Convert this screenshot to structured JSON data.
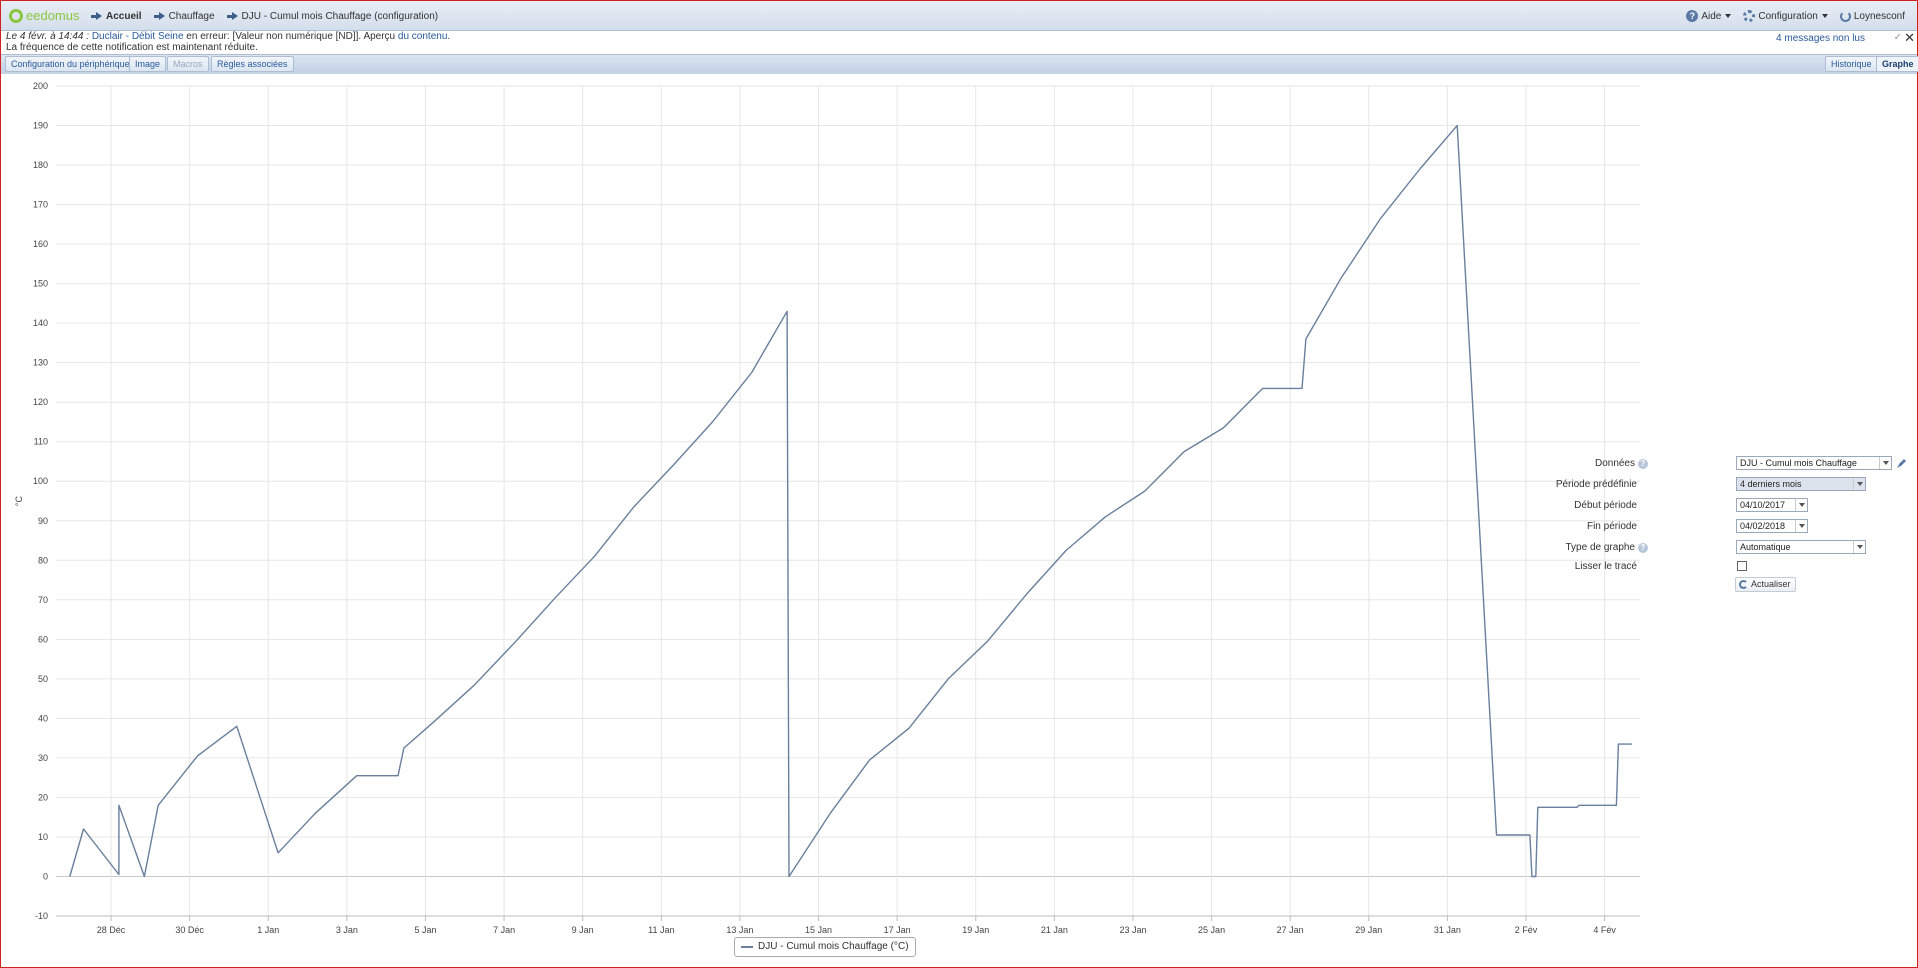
{
  "app": {
    "logo_text": "eedomus"
  },
  "breadcrumb": [
    "Accueil",
    "Chauffage",
    "DJU - Cumul mois Chauffage (configuration)"
  ],
  "topright": {
    "help": "Aide",
    "config": "Configuration",
    "user": "Loynesconf"
  },
  "notification": {
    "date": "Le 4 févr. à 14:44 :",
    "device": "Duclair - Débit Seine",
    "text1": " en erreur: [Valeur non numérique [ND]]. Aperçu ",
    "link": "du contenu",
    "text2": ".",
    "line2": "La fréquence de cette notification est maintenant réduite.",
    "unread": "4 messages non lus",
    "close": "✕"
  },
  "tabs": {
    "config": "Configuration du périphérique",
    "image": "Image",
    "macros": "Macros",
    "rules": "Règles associées",
    "history": "Historique",
    "graph": "Graphe"
  },
  "form": {
    "data_label": "Données",
    "data_value": "DJU - Cumul mois Chauffage",
    "period_label": "Période prédéfinie",
    "period_value": "4 derniers mois",
    "start_label": "Début période",
    "start_value": "04/10/2017",
    "end_label": "Fin période",
    "end_value": "04/02/2018",
    "type_label": "Type de graphe",
    "type_value": "Automatique",
    "smooth_label": "Lisser le tracé",
    "smooth_checked": false,
    "refresh_button": "Actualiser"
  },
  "chart_data": {
    "type": "line",
    "title": "",
    "ylabel": "°C",
    "xlabel": "",
    "ylim": [
      -10,
      200
    ],
    "yticks": [
      -10,
      0,
      10,
      20,
      30,
      40,
      50,
      60,
      70,
      80,
      90,
      100,
      110,
      120,
      130,
      140,
      150,
      160,
      170,
      180,
      190,
      200
    ],
    "xticks": [
      "28 Déc",
      "30 Déc",
      "1 Jan",
      "3 Jan",
      "5 Jan",
      "7 Jan",
      "9 Jan",
      "11 Jan",
      "13 Jan",
      "15 Jan",
      "17 Jan",
      "19 Jan",
      "21 Jan",
      "23 Jan",
      "25 Jan",
      "27 Jan",
      "29 Jan",
      "31 Jan",
      "2 Fév",
      "4 Fév"
    ],
    "xtick_days": [
      0,
      2,
      4,
      6,
      8,
      10,
      12,
      14,
      16,
      18,
      20,
      22,
      24,
      26,
      28,
      30,
      32,
      34,
      36,
      38
    ],
    "xlim_days": [
      -1.4,
      38.9
    ],
    "grid": true,
    "legend": "bottom-center",
    "series": [
      {
        "name": "DJU - Cumul mois Chauffage (°C)",
        "color": "#6a7f9c",
        "points_day": [
          [
            -1.05,
            0
          ],
          [
            -0.7,
            12
          ],
          [
            0.2,
            0.5
          ],
          [
            0.2,
            18
          ],
          [
            0.85,
            0
          ],
          [
            1.2,
            18
          ],
          [
            2.2,
            30.5
          ],
          [
            3.2,
            38
          ],
          [
            4.25,
            6
          ],
          [
            5.2,
            16
          ],
          [
            6.25,
            25.5
          ],
          [
            7.3,
            25.5
          ],
          [
            7.45,
            32.5
          ],
          [
            8.2,
            39
          ],
          [
            9.25,
            48.5
          ],
          [
            10.3,
            59.5
          ],
          [
            11.3,
            70.5
          ],
          [
            12.3,
            81
          ],
          [
            13.3,
            93.5
          ],
          [
            14.3,
            104
          ],
          [
            15.3,
            115
          ],
          [
            16.3,
            127.5
          ],
          [
            17.2,
            143
          ],
          [
            17.25,
            0
          ],
          [
            18.3,
            16
          ],
          [
            19.3,
            29.5
          ],
          [
            20.3,
            37.5
          ],
          [
            21.3,
            50
          ],
          [
            22.3,
            59.5
          ],
          [
            23.3,
            71.5
          ],
          [
            24.3,
            82.5
          ],
          [
            25.3,
            91
          ],
          [
            26.3,
            97.5
          ],
          [
            27.3,
            107.5
          ],
          [
            28.3,
            113.5
          ],
          [
            29.3,
            123.5
          ],
          [
            30.3,
            123.5
          ],
          [
            30.4,
            136
          ],
          [
            31.3,
            151.5
          ],
          [
            32.3,
            166.5
          ],
          [
            33.3,
            179
          ],
          [
            34.25,
            190
          ],
          [
            35.25,
            10.5
          ],
          [
            36.1,
            10.5
          ],
          [
            36.15,
            0
          ],
          [
            36.25,
            0
          ],
          [
            36.3,
            17.5
          ],
          [
            37.3,
            17.5
          ],
          [
            37.35,
            18
          ],
          [
            38.3,
            18
          ],
          [
            38.35,
            33.5
          ],
          [
            38.7,
            33.5
          ]
        ]
      }
    ]
  }
}
